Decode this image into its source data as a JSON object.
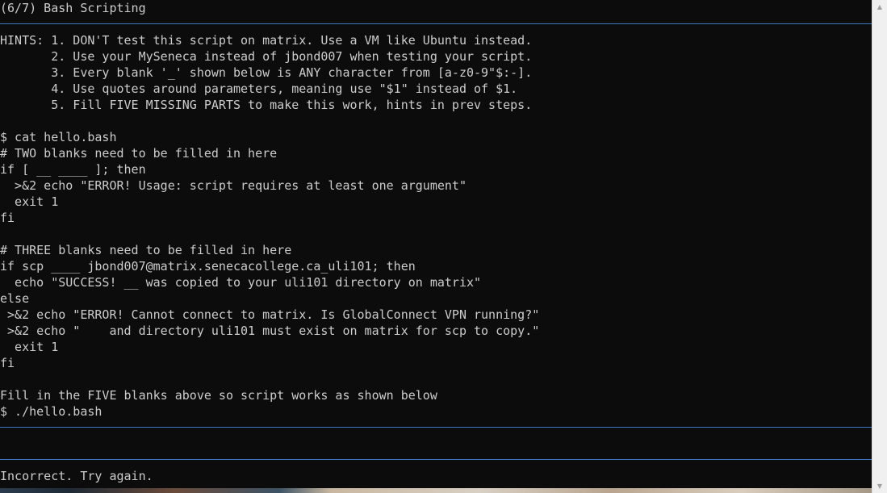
{
  "terminal": {
    "lines": [
      "(6/7) Bash Scripting",
      "",
      "HINTS: 1. DON'T test this script on matrix. Use a VM like Ubuntu instead.",
      "       2. Use your MySeneca instead of jbond007 when testing your script.",
      "       3. Every blank '_' shown below is ANY character from [a-z0-9\"$:-].",
      "       4. Use quotes around parameters, meaning use \"$1\" instead of $1.",
      "       5. Fill FIVE MISSING PARTS to make this work, hints in prev steps.",
      "",
      "$ cat hello.bash",
      "# TWO blanks need to be filled in here",
      "if [ __ ____ ]; then",
      "  >&2 echo \"ERROR! Usage: script requires at least one argument\"",
      "  exit 1",
      "fi",
      "",
      "# THREE blanks need to be filled in here",
      "if scp ____ jbond007@matrix.senecacollege.ca_uli101; then",
      "  echo \"SUCCESS! __ was copied to your uli101 directory on matrix\"",
      "else",
      " >&2 echo \"ERROR! Cannot connect to matrix. Is GlobalConnect VPN running?\"",
      " >&2 echo \"    and directory uli101 must exist on matrix for scp to copy.\"",
      "  exit 1",
      "fi",
      "",
      "Fill in the FIVE blanks above so script works as shown below",
      "$ ./hello.bash"
    ],
    "input_line": "",
    "feedback": "Incorrect. Try again."
  },
  "scrollbar": {
    "up_icon": "triangle-up",
    "down_icon": "triangle-down"
  },
  "colors": {
    "background": "#0c0c0c",
    "text": "#cccccc",
    "rule": "#3a78c3"
  }
}
